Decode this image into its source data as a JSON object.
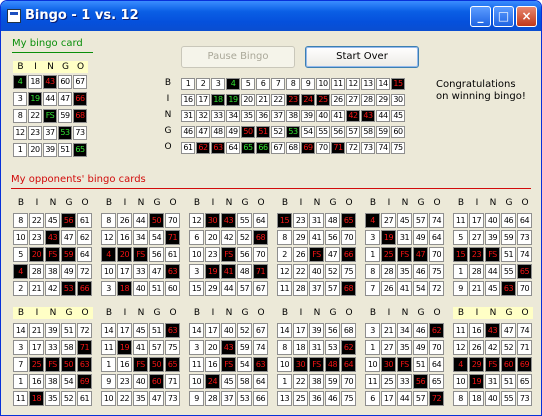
{
  "window": {
    "title": "Bingo - 1 vs. 12"
  },
  "labels": {
    "my_card": "My bingo card",
    "opponents": "My opponents' bingo cards",
    "congrats": [
      "Congratulations",
      "on winning bingo!"
    ]
  },
  "buttons": {
    "pause": "Pause Bingo",
    "start_over": "Start Over"
  },
  "letters": [
    "B",
    "I",
    "N",
    "G",
    "O"
  ],
  "colors": {
    "called": "#f31414",
    "winning": "#33e233",
    "my_card_rule": "#0a8f0a",
    "opponents_rule": "#d20b0b"
  },
  "my_card": {
    "header_highlight": true,
    "rows": [
      [
        "4",
        "18",
        "43",
        "60",
        "67"
      ],
      [
        "3",
        "19",
        "44",
        "47",
        "66"
      ],
      [
        "8",
        "22",
        "FS",
        "59",
        "68"
      ],
      [
        "12",
        "23",
        "37",
        "53",
        "73"
      ],
      [
        "1",
        "20",
        "39",
        "51",
        "65"
      ]
    ],
    "called": [
      [
        0,
        2
      ],
      [
        1,
        4
      ],
      [
        2,
        4
      ]
    ],
    "win": [
      [
        0,
        0
      ],
      [
        1,
        1
      ],
      [
        2,
        2
      ],
      [
        3,
        3
      ],
      [
        4,
        4
      ]
    ]
  },
  "called_board": {
    "rows": [
      [
        "1",
        "2",
        "3",
        "4",
        "5",
        "6",
        "7",
        "8",
        "9",
        "10",
        "11",
        "12",
        "13",
        "14",
        "15"
      ],
      [
        "16",
        "17",
        "18",
        "19",
        "20",
        "21",
        "22",
        "23",
        "24",
        "25",
        "26",
        "27",
        "28",
        "29",
        "30"
      ],
      [
        "31",
        "32",
        "33",
        "34",
        "35",
        "36",
        "37",
        "38",
        "39",
        "40",
        "41",
        "42",
        "43",
        "44",
        "45"
      ],
      [
        "46",
        "47",
        "48",
        "49",
        "50",
        "51",
        "52",
        "53",
        "54",
        "55",
        "56",
        "57",
        "58",
        "59",
        "60"
      ],
      [
        "61",
        "62",
        "63",
        "64",
        "65",
        "66",
        "67",
        "68",
        "69",
        "70",
        "71",
        "72",
        "73",
        "74",
        "75"
      ]
    ],
    "called": [
      [
        0,
        14
      ],
      [
        1,
        7
      ],
      [
        1,
        8
      ],
      [
        1,
        9
      ],
      [
        2,
        11
      ],
      [
        2,
        12
      ],
      [
        3,
        4
      ],
      [
        3,
        5
      ],
      [
        4,
        1
      ],
      [
        4,
        2
      ],
      [
        4,
        8
      ],
      [
        4,
        10
      ]
    ],
    "win": [
      [
        0,
        3
      ],
      [
        1,
        2
      ],
      [
        1,
        3
      ],
      [
        3,
        7
      ],
      [
        4,
        4
      ],
      [
        4,
        5
      ]
    ]
  },
  "opponents": [
    {
      "hl": false,
      "rows": [
        [
          "8",
          "22",
          "45",
          "56",
          "61"
        ],
        [
          "10",
          "23",
          "43",
          "47",
          "62"
        ],
        [
          "5",
          "20",
          "FS",
          "59",
          "64"
        ],
        [
          "4",
          "28",
          "38",
          "49",
          "72"
        ],
        [
          "2",
          "21",
          "42",
          "53",
          "66"
        ]
      ],
      "called": [
        [
          0,
          3
        ],
        [
          1,
          2
        ],
        [
          2,
          1
        ],
        [
          2,
          2
        ],
        [
          2,
          3
        ],
        [
          3,
          0
        ],
        [
          4,
          3
        ],
        [
          4,
          4
        ]
      ]
    },
    {
      "hl": false,
      "rows": [
        [
          "8",
          "26",
          "44",
          "50",
          "70"
        ],
        [
          "12",
          "16",
          "34",
          "54",
          "71"
        ],
        [
          "4",
          "20",
          "FS",
          "56",
          "61"
        ],
        [
          "10",
          "17",
          "33",
          "47",
          "63"
        ],
        [
          "3",
          "18",
          "40",
          "51",
          "60"
        ]
      ],
      "called": [
        [
          0,
          3
        ],
        [
          1,
          4
        ],
        [
          2,
          0
        ],
        [
          2,
          1
        ],
        [
          2,
          2
        ],
        [
          3,
          4
        ],
        [
          4,
          1
        ]
      ]
    },
    {
      "hl": false,
      "rows": [
        [
          "12",
          "30",
          "43",
          "55",
          "64"
        ],
        [
          "6",
          "20",
          "42",
          "52",
          "68"
        ],
        [
          "10",
          "23",
          "FS",
          "56",
          "70"
        ],
        [
          "3",
          "19",
          "41",
          "48",
          "71"
        ],
        [
          "15",
          "29",
          "44",
          "57",
          "67"
        ]
      ],
      "called": [
        [
          0,
          1
        ],
        [
          0,
          2
        ],
        [
          1,
          4
        ],
        [
          2,
          2
        ],
        [
          3,
          1
        ],
        [
          3,
          2
        ],
        [
          3,
          4
        ]
      ]
    },
    {
      "hl": false,
      "rows": [
        [
          "15",
          "23",
          "31",
          "48",
          "65"
        ],
        [
          "8",
          "29",
          "41",
          "56",
          "70"
        ],
        [
          "2",
          "26",
          "FS",
          "47",
          "66"
        ],
        [
          "12",
          "22",
          "40",
          "52",
          "75"
        ],
        [
          "11",
          "28",
          "37",
          "57",
          "68"
        ]
      ],
      "called": [
        [
          0,
          0
        ],
        [
          0,
          4
        ],
        [
          2,
          2
        ],
        [
          2,
          4
        ],
        [
          4,
          4
        ]
      ]
    },
    {
      "hl": false,
      "rows": [
        [
          "4",
          "27",
          "45",
          "57",
          "74"
        ],
        [
          "3",
          "19",
          "31",
          "49",
          "64"
        ],
        [
          "1",
          "25",
          "FS",
          "47",
          "70"
        ],
        [
          "8",
          "28",
          "35",
          "46",
          "75"
        ],
        [
          "7",
          "26",
          "41",
          "54",
          "72"
        ]
      ],
      "called": [
        [
          0,
          0
        ],
        [
          1,
          1
        ],
        [
          2,
          1
        ],
        [
          2,
          2
        ],
        [
          2,
          3
        ]
      ]
    },
    {
      "hl": false,
      "rows": [
        [
          "11",
          "17",
          "40",
          "46",
          "64"
        ],
        [
          "5",
          "27",
          "39",
          "59",
          "73"
        ],
        [
          "15",
          "23",
          "FS",
          "51",
          "74"
        ],
        [
          "1",
          "28",
          "44",
          "55",
          "65"
        ],
        [
          "9",
          "21",
          "45",
          "63",
          "70"
        ]
      ],
      "called": [
        [
          2,
          0
        ],
        [
          2,
          1
        ],
        [
          2,
          2
        ],
        [
          3,
          4
        ],
        [
          4,
          3
        ]
      ]
    },
    {
      "hl": true,
      "rows": [
        [
          "14",
          "21",
          "39",
          "51",
          "72"
        ],
        [
          "3",
          "17",
          "33",
          "58",
          "71"
        ],
        [
          "7",
          "25",
          "FS",
          "50",
          "63"
        ],
        [
          "1",
          "16",
          "38",
          "54",
          "69"
        ],
        [
          "11",
          "18",
          "35",
          "52",
          "61"
        ]
      ],
      "called": [
        [
          1,
          4
        ],
        [
          2,
          1
        ],
        [
          2,
          2
        ],
        [
          2,
          3
        ],
        [
          2,
          4
        ],
        [
          3,
          4
        ],
        [
          4,
          1
        ]
      ]
    },
    {
      "hl": false,
      "rows": [
        [
          "14",
          "17",
          "45",
          "51",
          "63"
        ],
        [
          "11",
          "19",
          "41",
          "57",
          "75"
        ],
        [
          "1",
          "16",
          "FS",
          "50",
          "65"
        ],
        [
          "9",
          "23",
          "40",
          "60",
          "71"
        ],
        [
          "10",
          "22",
          "35",
          "47",
          "73"
        ]
      ],
      "called": [
        [
          0,
          4
        ],
        [
          1,
          1
        ],
        [
          2,
          2
        ],
        [
          2,
          3
        ],
        [
          2,
          4
        ],
        [
          3,
          3
        ]
      ]
    },
    {
      "hl": false,
      "rows": [
        [
          "14",
          "17",
          "40",
          "52",
          "67"
        ],
        [
          "3",
          "20",
          "43",
          "59",
          "74"
        ],
        [
          "11",
          "16",
          "FS",
          "54",
          "63"
        ],
        [
          "10",
          "24",
          "45",
          "58",
          "64"
        ],
        [
          "9",
          "28",
          "37",
          "53",
          "66"
        ]
      ],
      "called": [
        [
          1,
          2
        ],
        [
          2,
          2
        ],
        [
          2,
          4
        ],
        [
          3,
          1
        ]
      ]
    },
    {
      "hl": false,
      "rows": [
        [
          "14",
          "17",
          "39",
          "56",
          "68"
        ],
        [
          "8",
          "18",
          "31",
          "53",
          "62"
        ],
        [
          "10",
          "30",
          "FS",
          "48",
          "64"
        ],
        [
          "1",
          "22",
          "38",
          "59",
          "70"
        ],
        [
          "13",
          "25",
          "36",
          "46",
          "75"
        ]
      ],
      "called": [
        [
          1,
          4
        ],
        [
          2,
          1
        ],
        [
          2,
          2
        ],
        [
          2,
          3
        ],
        [
          2,
          4
        ]
      ]
    },
    {
      "hl": false,
      "rows": [
        [
          "3",
          "21",
          "34",
          "46",
          "62"
        ],
        [
          "1",
          "27",
          "35",
          "49",
          "70"
        ],
        [
          "10",
          "30",
          "FS",
          "51",
          "64"
        ],
        [
          "11",
          "25",
          "33",
          "56",
          "65"
        ],
        [
          "6",
          "17",
          "44",
          "57",
          "72"
        ]
      ],
      "called": [
        [
          0,
          4
        ],
        [
          2,
          1
        ],
        [
          2,
          2
        ],
        [
          3,
          3
        ],
        [
          4,
          4
        ]
      ]
    },
    {
      "hl": true,
      "rows": [
        [
          "11",
          "16",
          "43",
          "47",
          "74"
        ],
        [
          "12",
          "26",
          "42",
          "52",
          "71"
        ],
        [
          "4",
          "29",
          "FS",
          "60",
          "69"
        ],
        [
          "10",
          "19",
          "31",
          "51",
          "65"
        ],
        [
          "8",
          "18",
          "40",
          "55",
          "73"
        ]
      ],
      "called": [
        [
          0,
          2
        ],
        [
          2,
          0
        ],
        [
          2,
          1
        ],
        [
          2,
          2
        ],
        [
          2,
          3
        ],
        [
          2,
          4
        ],
        [
          3,
          1
        ]
      ]
    }
  ]
}
